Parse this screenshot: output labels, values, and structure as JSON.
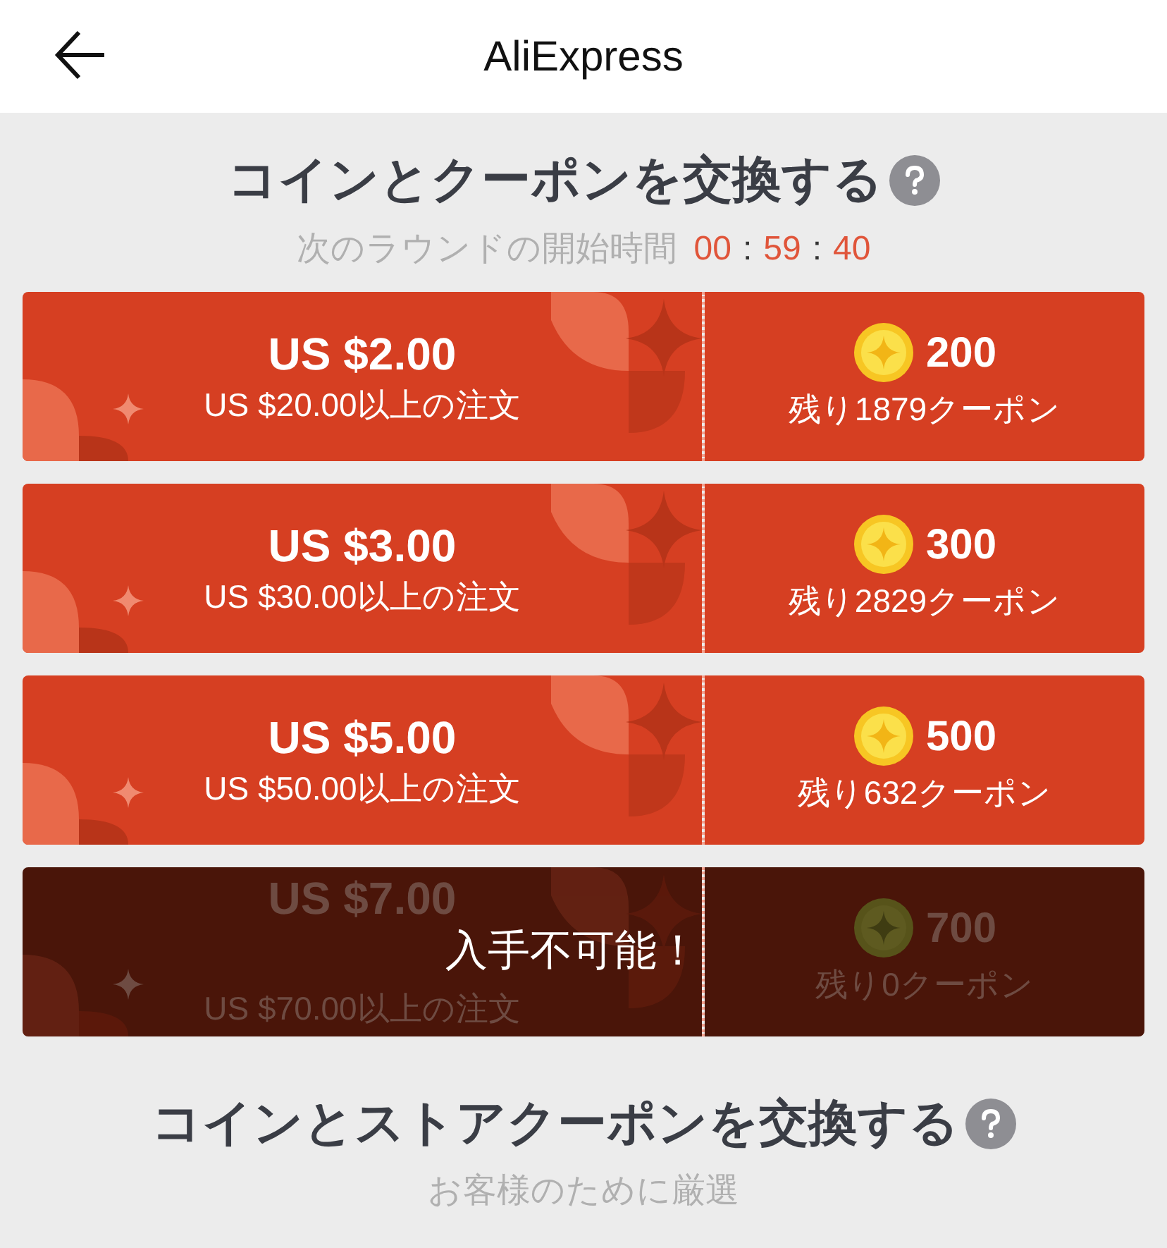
{
  "header": {
    "title": "AliExpress"
  },
  "coin_section": {
    "title": "コインとクーポンを交換する",
    "subtitle": "次のラウンドの開始時間",
    "timer": [
      "00",
      "59",
      "40"
    ],
    "separator": ":"
  },
  "coupons": [
    {
      "amount": "US $2.00",
      "condition": "US $20.00以上の注文",
      "coins": "200",
      "remaining": "残り1879クーポン",
      "available": true
    },
    {
      "amount": "US $3.00",
      "condition": "US $30.00以上の注文",
      "coins": "300",
      "remaining": "残り2829クーポン",
      "available": true
    },
    {
      "amount": "US $5.00",
      "condition": "US $50.00以上の注文",
      "coins": "500",
      "remaining": "残り632クーポン",
      "available": true
    },
    {
      "amount": "US $7.00",
      "condition": "US $70.00以上の注文",
      "coins": "700",
      "remaining": "残り0クーポン",
      "available": false,
      "overlay": "入手不可能！"
    }
  ],
  "store_section": {
    "title": "コインとストアクーポンを交換する",
    "subtitle": "お客様のために厳選"
  }
}
